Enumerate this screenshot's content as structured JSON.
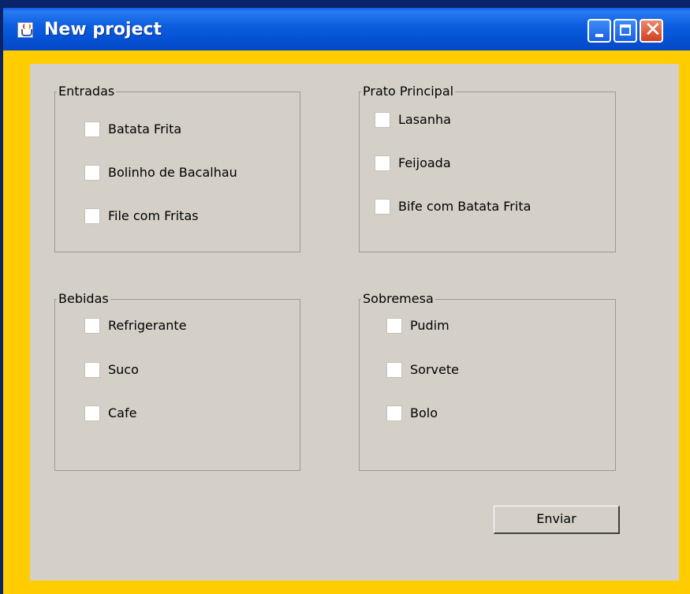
{
  "window": {
    "title": "New project",
    "controls": {
      "minimize": "minimize",
      "maximize": "maximize",
      "close": "close"
    }
  },
  "groups": [
    {
      "title": "Entradas",
      "items": [
        "Batata Frita",
        "Bolinho de Bacalhau",
        "File com Fritas"
      ]
    },
    {
      "title": "Prato Principal",
      "items": [
        "Lasanha",
        "Feijoada",
        "Bife com Batata Frita"
      ]
    },
    {
      "title": "Bebidas",
      "items": [
        "Refrigerante",
        "Suco",
        "Cafe"
      ]
    },
    {
      "title": "Sobremesa",
      "items": [
        "Pudim",
        "Sorvete",
        "Bolo"
      ]
    }
  ],
  "submit_label": "Enviar",
  "colors": {
    "title_bar": "#0553d6",
    "frame": "#ffcc00",
    "panel": "#d4d0c8"
  },
  "icons": {
    "app": "java-cup-icon",
    "minimize": "minimize-icon",
    "maximize": "maximize-icon",
    "close": "close-icon"
  }
}
